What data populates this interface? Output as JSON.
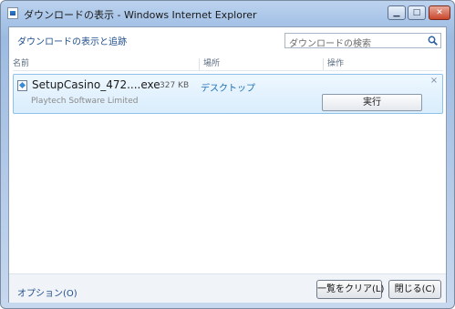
{
  "window": {
    "title": "ダウンロードの表示 - Windows Internet Explorer",
    "controls": {
      "minimize": "▁",
      "maximize": "□",
      "close": "✕"
    }
  },
  "header": {
    "link": "ダウンロードの表示と追跡",
    "search_placeholder": "ダウンロードの検索"
  },
  "columns": [
    "名前",
    "場所",
    "操作"
  ],
  "downloads": [
    {
      "name": "SetupCasino_472....exe",
      "size": "327 KB",
      "location": "デスクトップ",
      "publisher": "Playtech Software Limited",
      "action": "実行",
      "dismiss": "×"
    }
  ],
  "footer": {
    "options_link": "オプション(O)",
    "clear_button": "一覧をクリア(L)",
    "close_button": "閉じる(C)"
  },
  "icons": {
    "app": "ie-icon",
    "search": "search-icon",
    "file": "file-icon"
  }
}
